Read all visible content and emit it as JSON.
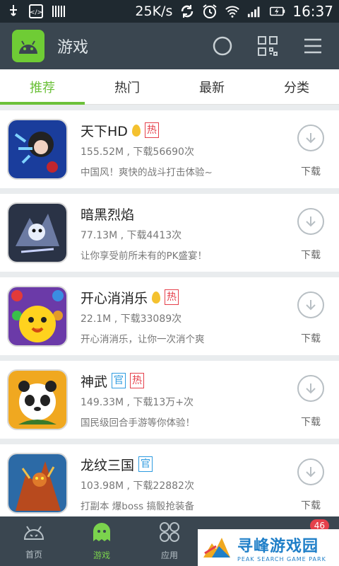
{
  "status_bar": {
    "speed": "25K/s",
    "time": "16:37"
  },
  "header": {
    "title": "游戏"
  },
  "tabs": [
    {
      "label": "推荐",
      "active": true
    },
    {
      "label": "热门",
      "active": false
    },
    {
      "label": "最新",
      "active": false
    },
    {
      "label": "分类",
      "active": false
    }
  ],
  "apps": [
    {
      "name": "天下HD",
      "egg": true,
      "tags": [
        "热"
      ],
      "meta": "155.52M , 下载56690次",
      "desc": "中国风！爽快的战斗打击体验~",
      "download": "下载"
    },
    {
      "name": "暗黑烈焰",
      "egg": false,
      "tags": [],
      "meta": "77.13M , 下载4413次",
      "desc": "让你享受前所未有的PK盛宴！",
      "download": "下载"
    },
    {
      "name": "开心消消乐",
      "egg": true,
      "tags": [
        "热"
      ],
      "meta": "22.1M , 下载33089次",
      "desc": "开心消消乐，让你一次消个爽",
      "download": "下载"
    },
    {
      "name": "神武",
      "egg": false,
      "tags": [
        "官",
        "热"
      ],
      "meta": "149.33M , 下载13万+次",
      "desc": "国民级回合手游等你体验！",
      "download": "下载"
    },
    {
      "name": "龙纹三国",
      "egg": false,
      "tags": [
        "官"
      ],
      "meta": "103.98M , 下载22882次",
      "desc": "打副本 爆boss 搞骰抢装备",
      "download": "下载"
    }
  ],
  "bottom_nav": [
    {
      "label": "首页",
      "active": false
    },
    {
      "label": "游戏",
      "active": true
    },
    {
      "label": "应用",
      "active": false
    },
    {
      "label": "",
      "active": false
    },
    {
      "label": "",
      "active": false,
      "badge": "46"
    }
  ],
  "watermark": {
    "cn": "寻峰游戏园",
    "en": "PEAK SEARCH GAME PARK"
  },
  "colors": {
    "accent": "#6cc13a",
    "header_bg": "#3a4650",
    "hot_tag": "#e5404b",
    "official_tag": "#2e9be0"
  }
}
